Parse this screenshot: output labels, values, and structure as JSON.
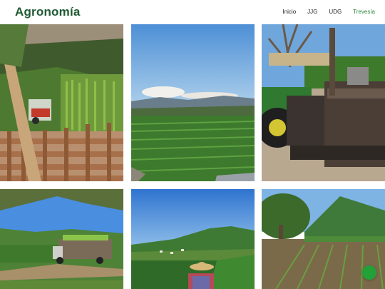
{
  "site": {
    "brand": "Agronomía",
    "nav": [
      {
        "label": "Inicio",
        "active": false
      },
      {
        "label": "JJG",
        "active": false
      },
      {
        "label": "UDG",
        "active": false
      },
      {
        "label": "Trevesía",
        "active": true
      }
    ],
    "accent_color": "#23a038",
    "brand_color": "#1f5a33"
  },
  "gallery": {
    "photos": [
      {
        "name": "photo-corn-harvester-fence"
      },
      {
        "name": "photo-crop-field-mountains"
      },
      {
        "name": "photo-tractor-closeup"
      },
      {
        "name": "photo-truck-on-dirt-road"
      },
      {
        "name": "photo-farmer-in-hat-valley"
      },
      {
        "name": "photo-tree-and-seedling-rows"
      }
    ]
  },
  "fab": {
    "icon": "chat-bubble-icon"
  }
}
